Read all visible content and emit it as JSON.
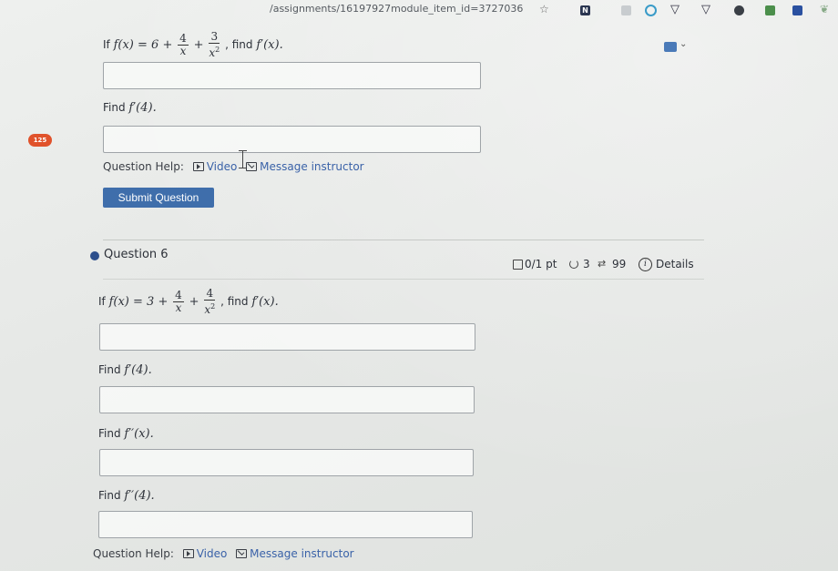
{
  "browser": {
    "url": "/assignments/16197927module_item_id=3727036"
  },
  "question5": {
    "prompt_prefix": "If",
    "expr_lhs": "f(x) = 6 +",
    "frac1": {
      "num": "4",
      "den": "x"
    },
    "frac2": {
      "num": "3",
      "den": "x",
      "exp": "2"
    },
    "prompt_suffix": ", find",
    "target": "f′(x).",
    "find_label": "Find",
    "find_expr": "f′(4).",
    "badge": "125",
    "help_label": "Question Help:",
    "video_label": "Video",
    "message_label": "Message instructor",
    "submit_label": "Submit Question"
  },
  "question6": {
    "title": "Question 6",
    "score": "0/1 pt",
    "retries": "3",
    "submissions": "99",
    "details_label": "Details",
    "prompt_prefix": "If",
    "expr_lhs": "f(x) = 3 +",
    "frac1": {
      "num": "4",
      "den": "x"
    },
    "frac2": {
      "num": "4",
      "den": "x",
      "exp": "2"
    },
    "prompt_suffix": ", find",
    "target": "f′(x).",
    "find_label": "Find",
    "find1_expr": "f′(4).",
    "find2_expr": "f′′(x).",
    "find3_expr": "f′′(4).",
    "help_label": "Question Help:",
    "video_label": "Video",
    "message_label": "Message instructor"
  }
}
